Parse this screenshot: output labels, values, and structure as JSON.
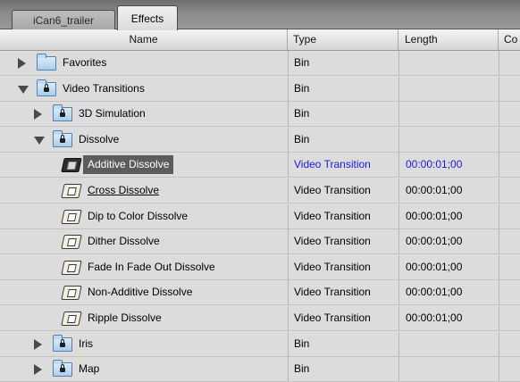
{
  "tabs": [
    {
      "label": "iCan6_trailer",
      "active": false
    },
    {
      "label": "Effects",
      "active": true
    }
  ],
  "columns": {
    "name": "Name",
    "type": "Type",
    "length": "Length",
    "co": "Co"
  },
  "colors": {
    "selected_text": "#1a1ae6",
    "selection_bg": "#5c5c5c",
    "row_bg": "#dcdcdc"
  },
  "rows": [
    {
      "name": "Favorites",
      "type": "Bin",
      "length": "",
      "kind": "bin",
      "depth": 0,
      "disclosure": "closed",
      "locked": false
    },
    {
      "name": "Video Transitions",
      "type": "Bin",
      "length": "",
      "kind": "bin",
      "depth": 0,
      "disclosure": "open",
      "locked": true
    },
    {
      "name": "3D Simulation",
      "type": "Bin",
      "length": "",
      "kind": "bin",
      "depth": 1,
      "disclosure": "closed",
      "locked": true
    },
    {
      "name": "Dissolve",
      "type": "Bin",
      "length": "",
      "kind": "bin",
      "depth": 1,
      "disclosure": "open",
      "locked": true
    },
    {
      "name": "Additive Dissolve",
      "type": "Video Transition",
      "length": "00:00:01;00",
      "kind": "transition",
      "selected": true
    },
    {
      "name": "Cross Dissolve",
      "type": "Video Transition",
      "length": "00:00:01;00",
      "kind": "transition",
      "underline": true
    },
    {
      "name": "Dip to Color Dissolve",
      "type": "Video Transition",
      "length": "00:00:01;00",
      "kind": "transition"
    },
    {
      "name": "Dither Dissolve",
      "type": "Video Transition",
      "length": "00:00:01;00",
      "kind": "transition"
    },
    {
      "name": "Fade In Fade Out Dissolve",
      "type": "Video Transition",
      "length": "00:00:01;00",
      "kind": "transition"
    },
    {
      "name": "Non-Additive Dissolve",
      "type": "Video Transition",
      "length": "00:00:01;00",
      "kind": "transition"
    },
    {
      "name": "Ripple Dissolve",
      "type": "Video Transition",
      "length": "00:00:01;00",
      "kind": "transition"
    },
    {
      "name": "Iris",
      "type": "Bin",
      "length": "",
      "kind": "bin",
      "depth": 1,
      "disclosure": "closed",
      "locked": true
    },
    {
      "name": "Map",
      "type": "Bin",
      "length": "",
      "kind": "bin",
      "depth": 1,
      "disclosure": "closed",
      "locked": true
    }
  ]
}
